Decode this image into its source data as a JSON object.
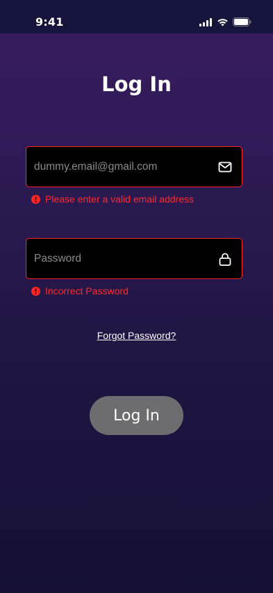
{
  "status_bar": {
    "time": "9:41"
  },
  "title": "Log In",
  "email": {
    "placeholder": "dummy.email@gmail.com",
    "value": "",
    "error": "Please enter a valid email address"
  },
  "password": {
    "placeholder": "Password",
    "value": "",
    "error": "Incorrect Password"
  },
  "forgot_password": "Forgot Password?",
  "login_button": "Log In",
  "colors": {
    "error": "#ff2424",
    "button": "#6d6d6f",
    "bg_top": "#3a1c5e",
    "bg_bottom": "#140f33"
  },
  "icons": {
    "email": "mail-icon",
    "password": "lock-icon",
    "error": "error-icon"
  }
}
